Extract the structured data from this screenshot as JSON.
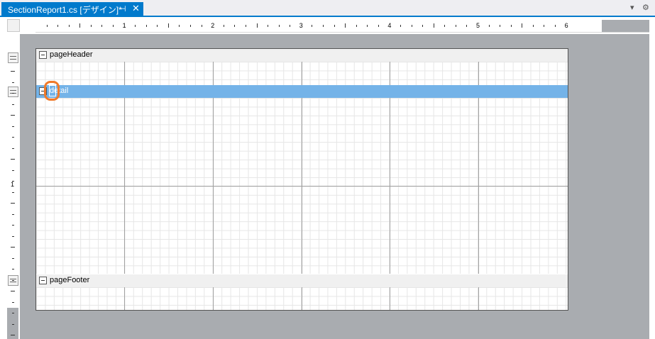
{
  "tab": {
    "title": "SectionReport1.cs [デザイン]*",
    "pin_icon": "pin-icon",
    "close_icon": "close-icon"
  },
  "toolbar": {
    "dropdown_icon": "chevron-down-icon",
    "settings_icon": "gear-icon"
  },
  "ruler": {
    "h_labels": [
      "1",
      "2",
      "3",
      "4",
      "5",
      "6"
    ],
    "v_labels": [
      "1"
    ]
  },
  "sections": [
    {
      "name": "pageHeader"
    },
    {
      "name": "detail",
      "selected": true
    },
    {
      "name": "pageFooter"
    }
  ],
  "colors": {
    "accent": "#007acc",
    "selected_section": "#74b3e8",
    "highlight": "#f07a2a",
    "canvas": "#a9acb0"
  }
}
